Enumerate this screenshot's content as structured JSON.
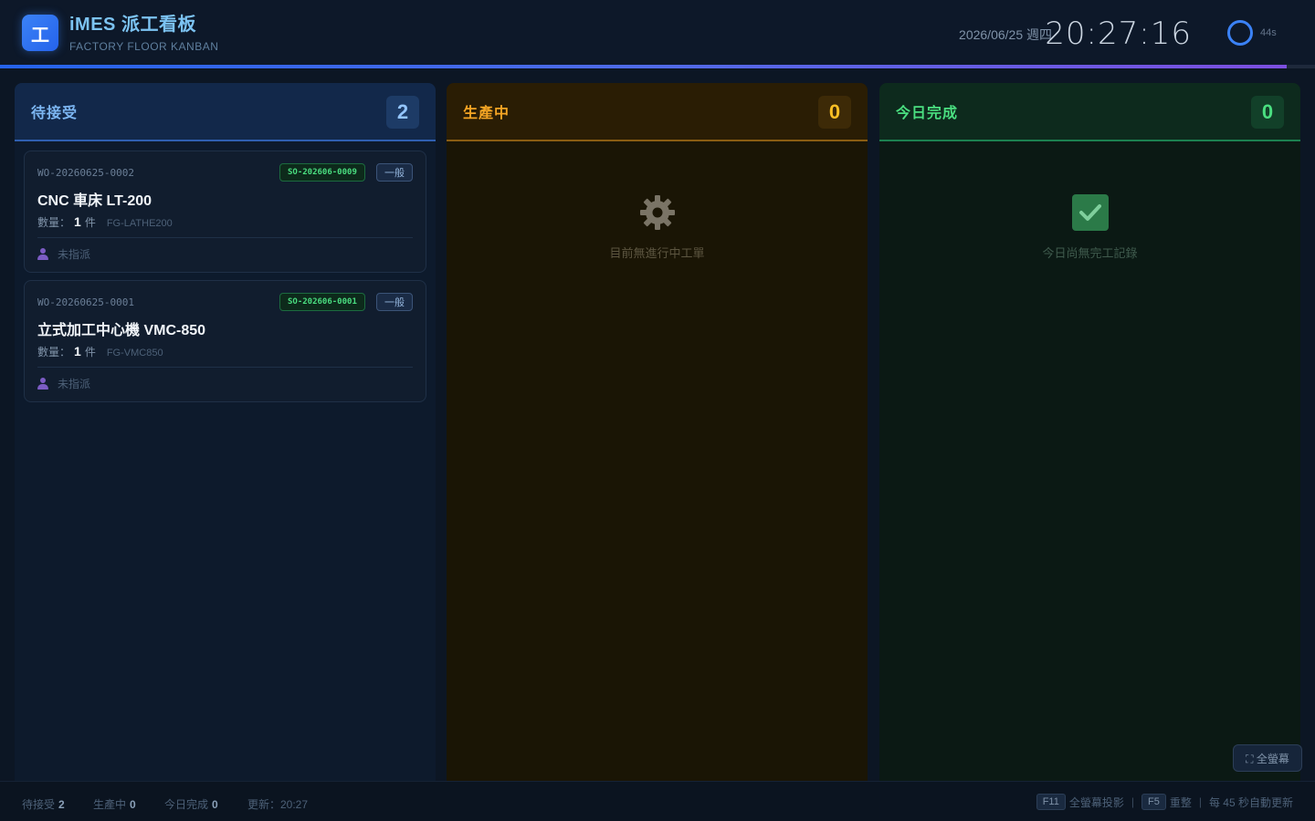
{
  "header": {
    "logo_char": "工",
    "title": "iMES 派工看板",
    "subtitle": "FACTORY FLOOR KANBAN",
    "date": "2026/06/25 週四",
    "time": "20:27:16",
    "refresh_countdown": "44s"
  },
  "columns": {
    "pending": {
      "title": "待接受",
      "count": "2"
    },
    "in_progress": {
      "title": "生產中",
      "count": "0",
      "empty_text": "目前無進行中工單",
      "empty_icon": "gear-icon"
    },
    "done": {
      "title": "今日完成",
      "count": "0",
      "empty_text": "今日尚無完工記錄",
      "empty_icon": "checkbox-icon"
    }
  },
  "cards": [
    {
      "wo": "WO-20260625-0002",
      "so": "SO-202606-0009",
      "priority": "一般",
      "product": "CNC 車床 LT-200",
      "qty_label": "數量：",
      "qty": "1",
      "unit": "件",
      "sku": "FG-LATHE200",
      "assignee": "未指派"
    },
    {
      "wo": "WO-20260625-0001",
      "so": "SO-202606-0001",
      "priority": "一般",
      "product": "立式加工中心機 VMC-850",
      "qty_label": "數量：",
      "qty": "1",
      "unit": "件",
      "sku": "FG-VMC850",
      "assignee": "未指派"
    }
  ],
  "fullscreen_button": "⛶ 全螢幕",
  "footer": {
    "pending_label": "待接受",
    "pending_count": "2",
    "progress_label": "生產中",
    "progress_count": "0",
    "done_label": "今日完成",
    "done_count": "0",
    "updated": "更新：20:27",
    "key_f11": "F11",
    "key_f11_label": "全螢幕投影",
    "key_f5": "F5",
    "key_f5_label": "重整",
    "auto_refresh": "每 45 秒自動更新"
  },
  "colors": {
    "accent": "#3b82f6",
    "pending": "#7cb6f2",
    "in_progress": "#f5a524",
    "done": "#4ade80"
  }
}
